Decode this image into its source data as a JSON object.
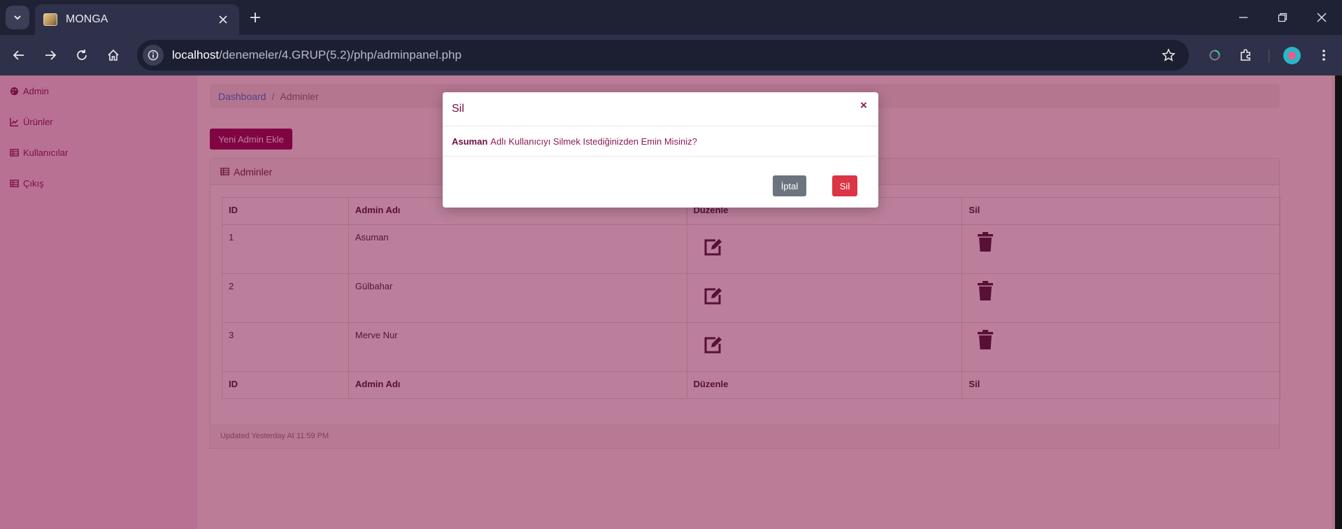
{
  "browser": {
    "tab_title": "MONGA",
    "url_host": "localhost",
    "url_path": "/denemeler/4.GRUP(5.2)/php/adminpanel.php"
  },
  "sidebar": {
    "items": [
      {
        "label": "Admin",
        "icon": "palette-icon"
      },
      {
        "label": "Ürünler",
        "icon": "chart-icon"
      },
      {
        "label": "Kullanıcılar",
        "icon": "table-icon"
      },
      {
        "label": "Çıkış",
        "icon": "table-icon"
      }
    ]
  },
  "breadcrumb": {
    "link": "Dashboard",
    "separator": "/",
    "active": "Adminler"
  },
  "add_button": "Yeni Admin Ekle",
  "card": {
    "title": "Adminler",
    "columns": [
      "ID",
      "Admin Adı",
      "Düzenle",
      "Sil"
    ],
    "rows": [
      {
        "id": "1",
        "name": "Asuman"
      },
      {
        "id": "2",
        "name": "Gülbahar"
      },
      {
        "id": "3",
        "name": "Merve Nur"
      }
    ],
    "footer": "Updated Yesterday At 11:59 PM"
  },
  "modal": {
    "title": "Sil",
    "close": "×",
    "body_name": "Asuman",
    "body_text": "Adlı Kullanıcıyı Silmek Istediğinizden Emin Misiniz?",
    "cancel": "İptal",
    "confirm": "Sil"
  },
  "colors": {
    "primary": "#8b0a4e",
    "danger": "#dc3545",
    "secondary": "#6c757d",
    "backdrop": "#780037"
  }
}
